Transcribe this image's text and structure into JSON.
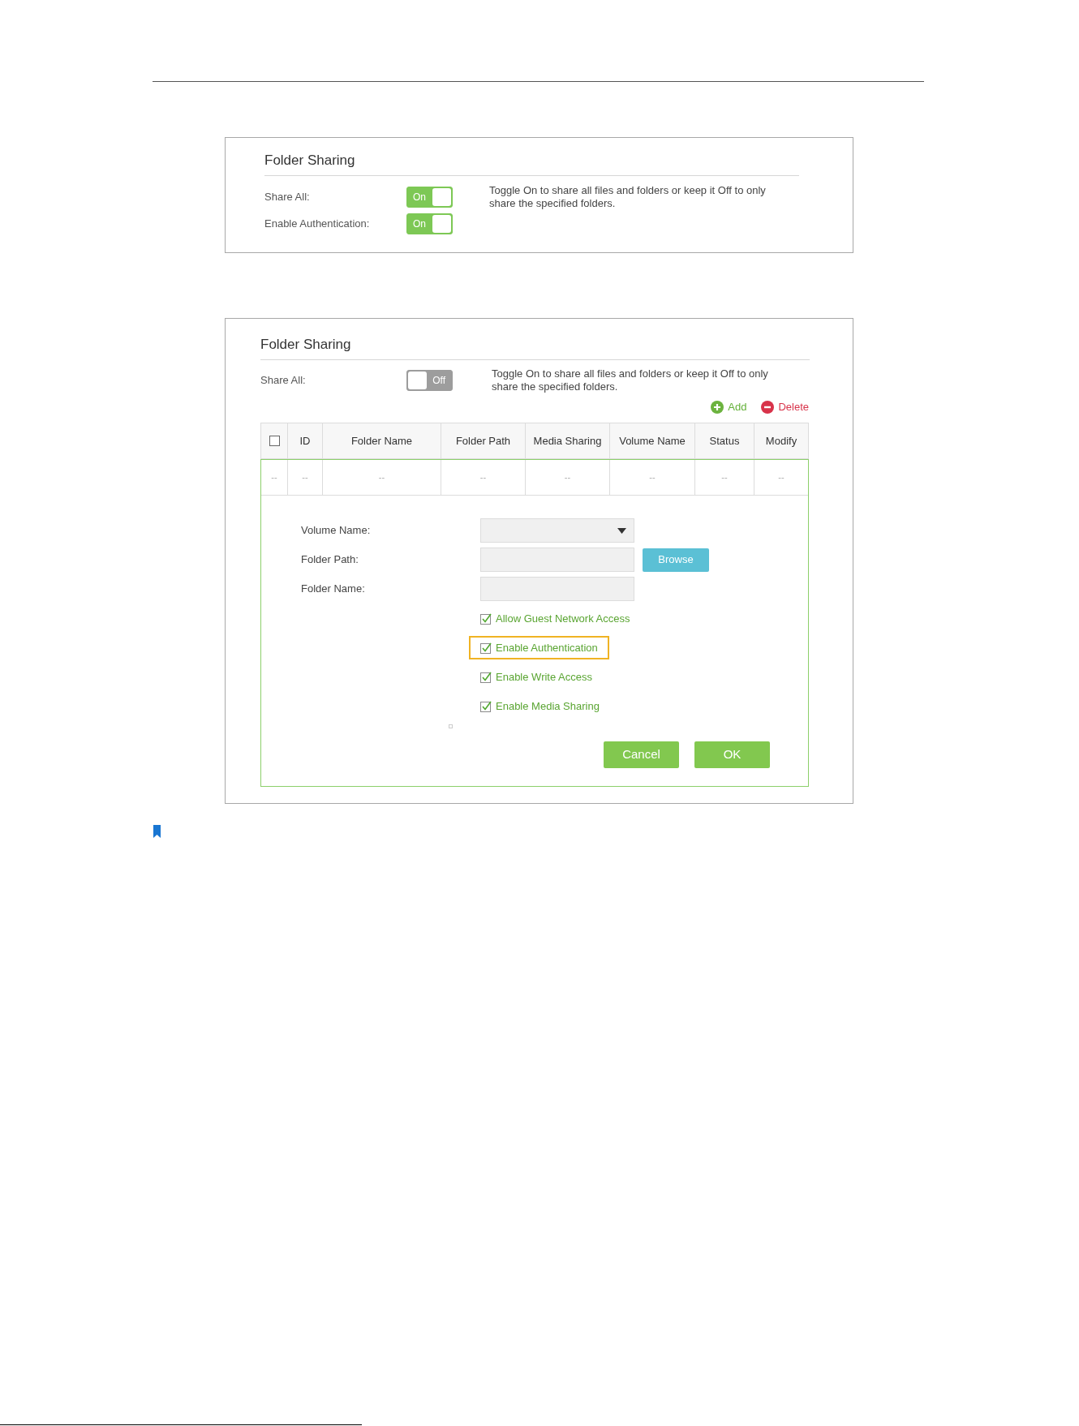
{
  "panels": [
    {
      "title": "Folder Sharing",
      "settings": [
        {
          "label": "Share All:",
          "toggle_text": "On",
          "on": true
        },
        {
          "label": "Enable Authentication:",
          "toggle_text": "On",
          "on": true
        }
      ],
      "description": "Toggle On to share all files and folders or keep it Off to only share the specified folders."
    },
    {
      "title": "Folder Sharing",
      "settings": [
        {
          "label": "Share All:",
          "toggle_text": "Off",
          "on": false
        }
      ],
      "description": "Toggle On to share all files and folders or keep it Off to only share the specified folders.",
      "actions": [
        {
          "kind": "add",
          "label": "Add"
        },
        {
          "kind": "delete",
          "label": "Delete"
        }
      ],
      "table": {
        "select_all_checked": false,
        "columns": [
          "",
          "ID",
          "Folder Name",
          "Folder Path",
          "Media Sharing",
          "Volume Name",
          "Status",
          "Modify"
        ],
        "rows": [
          {
            "selected": true,
            "cells": [
              "--",
              "--",
              "--",
              "--",
              "--",
              "--",
              "--",
              "--"
            ]
          }
        ]
      },
      "form": {
        "fields": [
          {
            "kind": "select",
            "label": "Volume Name:"
          },
          {
            "kind": "text",
            "label": "Folder Path:",
            "button": "Browse"
          },
          {
            "kind": "text",
            "label": "Folder Name:"
          }
        ],
        "options": [
          {
            "label": "Allow Guest Network Access",
            "checked": true,
            "highlighted": false
          },
          {
            "label": "Enable Authentication",
            "checked": true,
            "highlighted": true
          },
          {
            "label": "Enable Write Access",
            "checked": true,
            "highlighted": false
          },
          {
            "label": "Enable Media Sharing",
            "checked": true,
            "highlighted": false
          }
        ],
        "buttons": [
          "Cancel",
          "OK"
        ]
      }
    }
  ]
}
